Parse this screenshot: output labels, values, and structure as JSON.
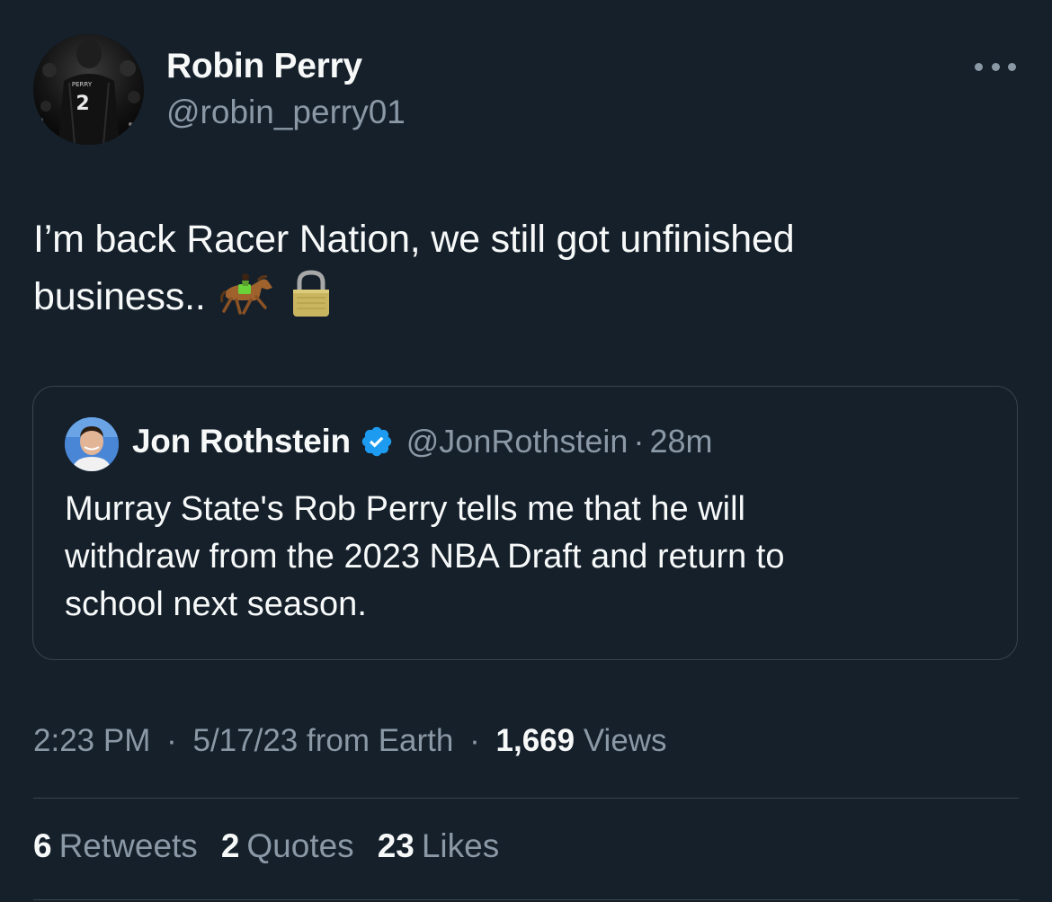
{
  "tweet": {
    "author": {
      "name": "Robin Perry",
      "handle": "@robin_perry01",
      "avatar_jersey_number": "2"
    },
    "text_lines": [
      "I’m back Racer Nation, we still got unfinished",
      "business.."
    ],
    "emojis": [
      "horse-racing-emoji",
      "lock-emoji"
    ],
    "more_icon": "more-options-icon",
    "quoted": {
      "name": "Jon Rothstein",
      "verified_icon": "verified-badge-icon",
      "handle": "@JonRothstein",
      "dot": "·",
      "time": "28m",
      "text_lines": [
        "Murray State's Rob Perry tells me that he will",
        "withdraw from the 2023 NBA Draft and return to",
        "school next season."
      ]
    },
    "meta": {
      "time": "2:23 PM",
      "sep1": "·",
      "date_location": "5/17/23 from Earth",
      "sep2": "·",
      "views_count": "1,669",
      "views_label": "Views"
    },
    "stats": {
      "retweets_count": "6",
      "retweets_label": "Retweets",
      "quotes_count": "2",
      "quotes_label": "Quotes",
      "likes_count": "23",
      "likes_label": "Likes"
    }
  },
  "colors": {
    "background": "#15202b",
    "text_primary": "#f7f9f9",
    "text_secondary": "#8b98a5",
    "border": "#38444d",
    "verified_blue": "#1d9bf0"
  }
}
